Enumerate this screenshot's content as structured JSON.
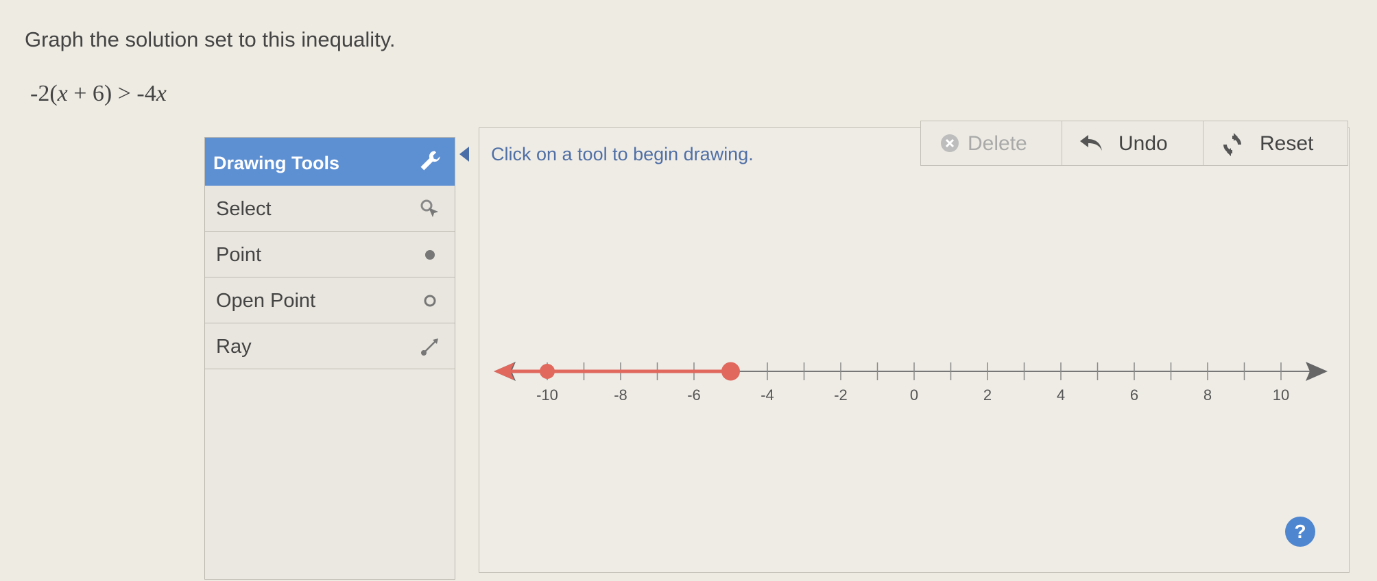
{
  "question": {
    "prompt": "Graph the solution set to this inequality.",
    "inequality_left": "-2(",
    "inequality_var1": "x",
    "inequality_mid": " + 6) > -4",
    "inequality_var2": "x"
  },
  "tools": {
    "header": "Drawing Tools",
    "items": [
      {
        "label": "Select",
        "icon": "select-cursor-icon"
      },
      {
        "label": "Point",
        "icon": "filled-dot-icon"
      },
      {
        "label": "Open Point",
        "icon": "open-circle-icon"
      },
      {
        "label": "Ray",
        "icon": "ray-icon"
      }
    ]
  },
  "canvas": {
    "instruction": "Click on a tool to begin drawing."
  },
  "buttons": {
    "delete": "Delete",
    "undo": "Undo",
    "reset": "Reset"
  },
  "help": "?",
  "numberline": {
    "min": -10,
    "max": 10,
    "labels": [
      "-10",
      "-8",
      "-6",
      "-4",
      "-2",
      "0",
      "2",
      "4",
      "6",
      "8",
      "10"
    ],
    "ray": {
      "from": -5,
      "direction": "left",
      "endpoint": "closed",
      "color": "#e0685d"
    }
  },
  "colors": {
    "header": "#5d8fd3",
    "ray": "#e0685d",
    "help": "#4e86cf"
  }
}
